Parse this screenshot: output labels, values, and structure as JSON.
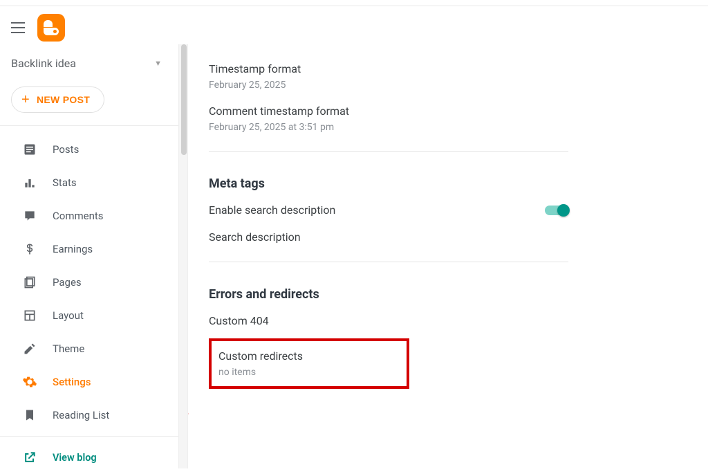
{
  "header": {},
  "sidebar": {
    "blog_name": "Backlink idea",
    "new_post_label": "NEW POST",
    "items": [
      {
        "label": "Posts"
      },
      {
        "label": "Stats"
      },
      {
        "label": "Comments"
      },
      {
        "label": "Earnings"
      },
      {
        "label": "Pages"
      },
      {
        "label": "Layout"
      },
      {
        "label": "Theme"
      },
      {
        "label": "Settings"
      },
      {
        "label": "Reading List"
      }
    ],
    "view_blog_label": "View blog"
  },
  "settings": {
    "timestamp_format": {
      "title": "Timestamp format",
      "value": "February 25, 2025"
    },
    "comment_timestamp_format": {
      "title": "Comment timestamp format",
      "value": "February 25, 2025 at 3:51 pm"
    },
    "meta_tags": {
      "heading": "Meta tags",
      "enable_search_desc": "Enable search description",
      "search_desc": "Search description"
    },
    "errors": {
      "heading": "Errors and redirects",
      "custom_404": "Custom 404",
      "custom_redirects": "Custom redirects",
      "no_items": "no items"
    }
  }
}
